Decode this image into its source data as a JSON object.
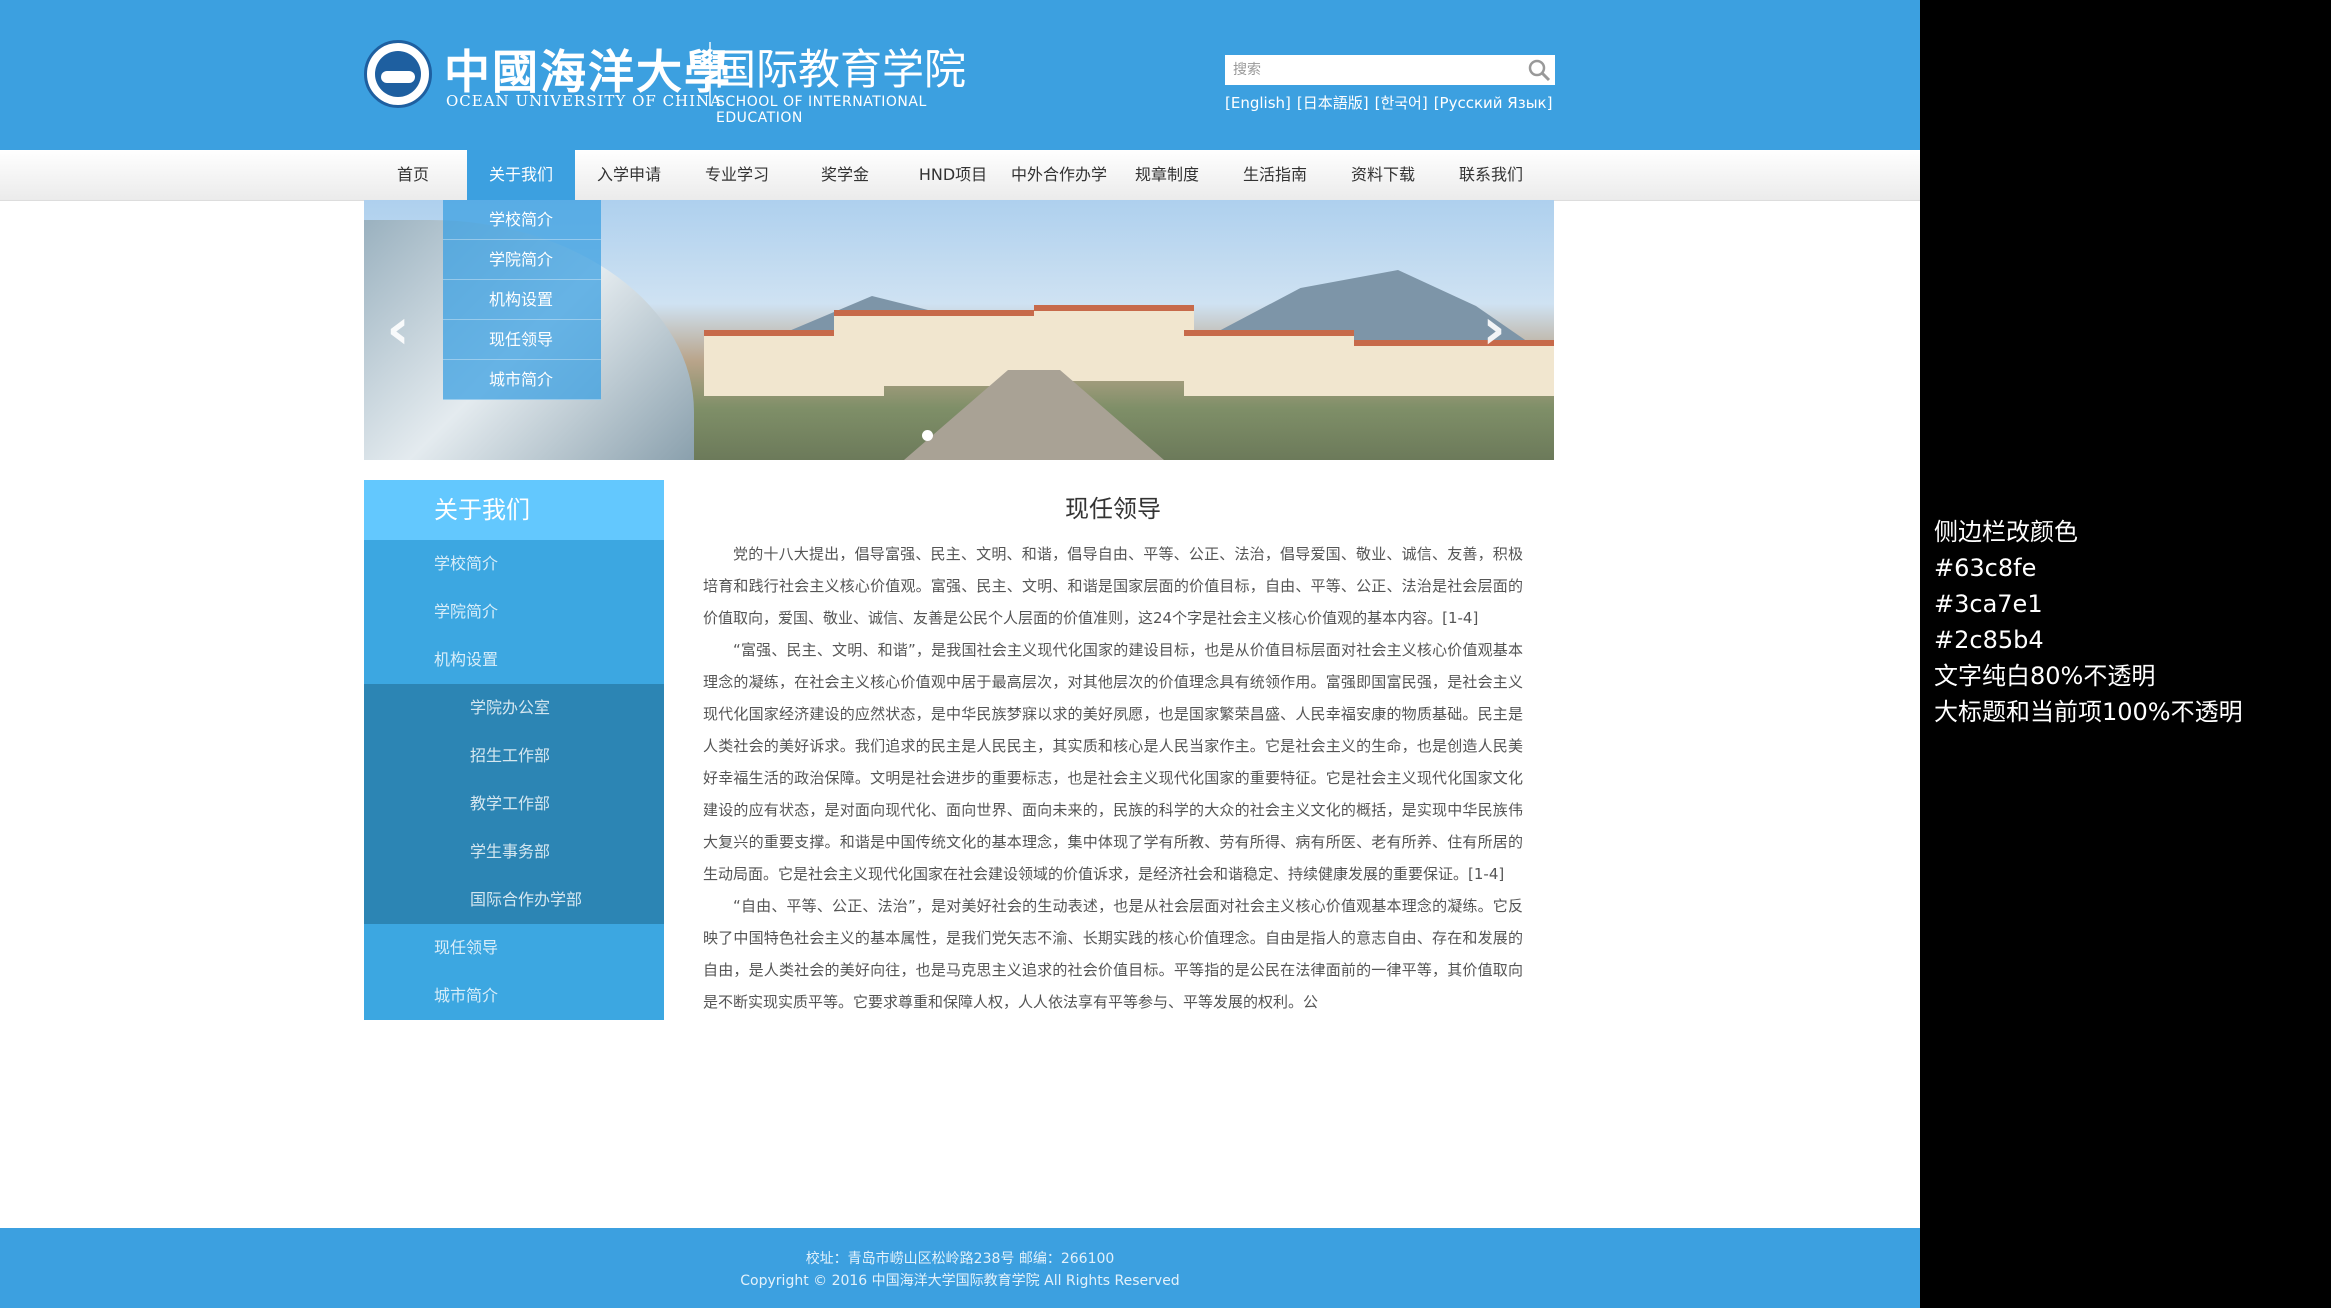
{
  "header": {
    "univ_cn": "中國海洋大學",
    "univ_en": "OCEAN UNIVERSITY OF CHINA",
    "school_cn": "国际教育学院",
    "school_en": "SCHOOL OF INTERNATIONAL EDUCATION",
    "search_placeholder": "搜索",
    "languages": [
      "[English]",
      "[日本語版]",
      "[한국어]",
      "[Русский Язык]"
    ]
  },
  "nav": {
    "items": [
      "首页",
      "关于我们",
      "入学申请",
      "专业学习",
      "奖学金",
      "HND项目",
      "中外合作办学",
      "规章制度",
      "生活指南",
      "资料下载",
      "联系我们"
    ],
    "active_index": 1
  },
  "dropdown": {
    "items": [
      "学校简介",
      "学院简介",
      "机构设置",
      "现任领导",
      "城市简介"
    ]
  },
  "sidebar": {
    "title": "关于我们",
    "items_top": [
      "学校简介",
      "学院简介",
      "机构设置"
    ],
    "sub_items": [
      "学院办公室",
      "招生工作部",
      "教学工作部",
      "学生事务部",
      "国际合作办学部"
    ],
    "items_bottom": [
      "现任领导",
      "城市简介"
    ]
  },
  "content": {
    "title": "现任领导",
    "paragraphs": [
      "党的十八大提出，倡导富强、民主、文明、和谐，倡导自由、平等、公正、法治，倡导爱国、敬业、诚信、友善，积极培育和践行社会主义核心价值观。富强、民主、文明、和谐是国家层面的价值目标，自由、平等、公正、法治是社会层面的价值取向，爱国、敬业、诚信、友善是公民个人层面的价值准则，这24个字是社会主义核心价值观的基本内容。[1-4]",
      "“富强、民主、文明、和谐”，是我国社会主义现代化国家的建设目标，也是从价值目标层面对社会主义核心价值观基本理念的凝练，在社会主义核心价值观中居于最高层次，对其他层次的价值理念具有统领作用。富强即国富民强，是社会主义现代化国家经济建设的应然状态，是中华民族梦寐以求的美好夙愿，也是国家繁荣昌盛、人民幸福安康的物质基础。民主是人类社会的美好诉求。我们追求的民主是人民民主，其实质和核心是人民当家作主。它是社会主义的生命，也是创造人民美好幸福生活的政治保障。文明是社会进步的重要标志，也是社会主义现代化国家的重要特征。它是社会主义现代化国家文化建设的应有状态，是对面向现代化、面向世界、面向未来的，民族的科学的大众的社会主义文化的概括，是实现中华民族伟大复兴的重要支撑。和谐是中国传统文化的基本理念，集中体现了学有所教、劳有所得、病有所医、老有所养、住有所居的生动局面。它是社会主义现代化国家在社会建设领域的价值诉求，是经济社会和谐稳定、持续健康发展的重要保证。[1-4]",
      "“自由、平等、公正、法治”，是对美好社会的生动表述，也是从社会层面对社会主义核心价值观基本理念的凝练。它反映了中国特色社会主义的基本属性，是我们党矢志不渝、长期实践的核心价值理念。自由是指人的意志自由、存在和发展的自由，是人类社会的美好向往，也是马克思主义追求的社会价值目标。平等指的是公民在法律面前的一律平等，其价值取向是不断实现实质平等。它要求尊重和保障人权，人人依法享有平等参与、平等发展的权利。公"
    ]
  },
  "footer": {
    "address": "校址：青岛市崂山区松岭路238号   邮编：266100",
    "copyright": "Copyright © 2016 中国海洋大学国际教育学院  All Rights Reserved"
  },
  "notes": [
    "侧边栏改颜色",
    "#63c8fe",
    "#3ca7e1",
    "#2c85b4",
    "文字纯白80%不透明",
    "大标题和当前项100%不透明"
  ],
  "colors": {
    "header": "#3ca0e0",
    "sidebar_title": "#63c8fe",
    "sidebar_item": "#3ca7e1",
    "sidebar_sub": "#2c85b4"
  }
}
